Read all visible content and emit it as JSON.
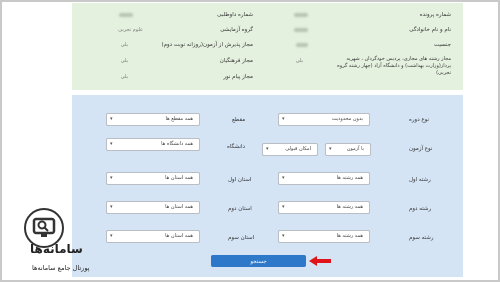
{
  "info_panel": {
    "rows": [
      {
        "label": "شماره پرونده",
        "value": "",
        "label2": "شماره داوطلبی",
        "value2": ""
      },
      {
        "label": "نام و نام خانوادگی",
        "value": "",
        "label2": "گروه آزمایشی",
        "value2": "علوم تجربی"
      },
      {
        "label": "جنسیت",
        "value": "",
        "label2": "مجاز پذیرش از آزمون(روزانه نوبت دوم)",
        "value2": "بلی"
      },
      {
        "label": "مجاز رشته های مجازی، پردیس خودگردان ، شهریه پرداز(وزارت بهداشت) و دانشگاه آزاد (چهار رشته گروه تجربی)",
        "value": "بلی",
        "label2": "مجاز فرهنگیان",
        "value2": "بلی"
      },
      {
        "label": "",
        "value": "",
        "label2": "مجاز پیام نور",
        "value2": "بلی"
      }
    ]
  },
  "form": {
    "course_type": {
      "label": "نوع دوره",
      "value": "بدون محدودیت"
    },
    "grade": {
      "label": "مقطع",
      "value": "همه مقطع ها"
    },
    "exam_type": {
      "label": "نوع آزمون",
      "value": "با آزمون",
      "value2": "امکان قبولی"
    },
    "university": {
      "label": "دانشگاه",
      "value": "همه دانشگاه ها"
    },
    "field1": {
      "label": "رشته اول",
      "value": "همه رشته ها"
    },
    "province1": {
      "label": "استان اول",
      "value": "همه استان ها"
    },
    "field2": {
      "label": "رشته دوم",
      "value": "همه رشته ها"
    },
    "province2": {
      "label": "استان دوم",
      "value": "همه استان ها"
    },
    "field3": {
      "label": "رشته سوم",
      "value": "همه رشته ها"
    },
    "province3": {
      "label": "استان سوم",
      "value": "همه استان ها"
    },
    "search_button": "جستجو"
  },
  "arrow_color": "#e0151b",
  "button_color": "#2e78c9",
  "watermark": {
    "title": "سامانه‌ها",
    "subtitle": "پورتال جامع سامانه‌ها"
  }
}
